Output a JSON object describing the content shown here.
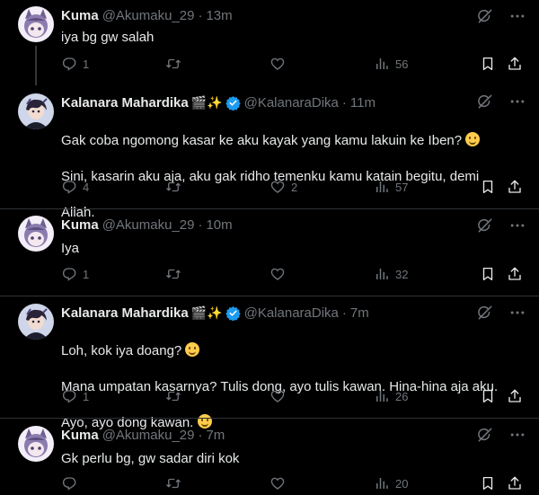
{
  "tweets": [
    {
      "name": "Kuma",
      "handle": "@Akumaku_29",
      "time": "13m",
      "text": "iya bg gw salah",
      "replies": "1",
      "retweets": "",
      "likes": "",
      "views": "56",
      "avatar": "kuma"
    },
    {
      "name": "Kalanara Mahardika",
      "emoji": "🎬✨",
      "verified": true,
      "handle": "@KalanaraDika",
      "time": "11m",
      "text_lines": [
        "Gak coba ngomong kasar ke aku kayak yang kamu lakuin ke Iben?",
        "Sini, kasarin aku aja, aku gak ridho temenku kamu katain begitu, demi",
        "Allah."
      ],
      "replies": "4",
      "retweets": "",
      "likes": "2",
      "views": "57",
      "avatar": "kalanara"
    },
    {
      "name": "Kuma",
      "handle": "@Akumaku_29",
      "time": "10m",
      "text": "Iya",
      "replies": "1",
      "retweets": "",
      "likes": "",
      "views": "32",
      "avatar": "kuma"
    },
    {
      "name": "Kalanara Mahardika",
      "emoji": "🎬✨",
      "verified": true,
      "handle": "@KalanaraDika",
      "time": "7m",
      "text_lines": [
        "Loh, kok iya doang?",
        "Mana umpatan kasarnya? Tulis dong, ayo tulis kawan. Hina-hina aja aku.",
        "Ayo, ayo dong kawan."
      ],
      "replies": "1",
      "retweets": "",
      "likes": "",
      "views": "26",
      "avatar": "kalanara"
    },
    {
      "name": "Kuma",
      "handle": "@Akumaku_29",
      "time": "7m",
      "text": "Gk perlu bg, gw sadar diri kok",
      "replies": "",
      "retweets": "",
      "likes": "",
      "views": "20",
      "avatar": "kuma"
    }
  ],
  "dot": "·",
  "colors": {
    "background": "#000000",
    "text": "#e7e9ea",
    "muted": "#71767b",
    "verified": "#1d9bf0",
    "thread_line": "#333639"
  },
  "icons": [
    "grok-icon",
    "more-icon",
    "reply-icon",
    "retweet-icon",
    "like-icon",
    "views-icon",
    "bookmark-icon",
    "share-icon"
  ]
}
